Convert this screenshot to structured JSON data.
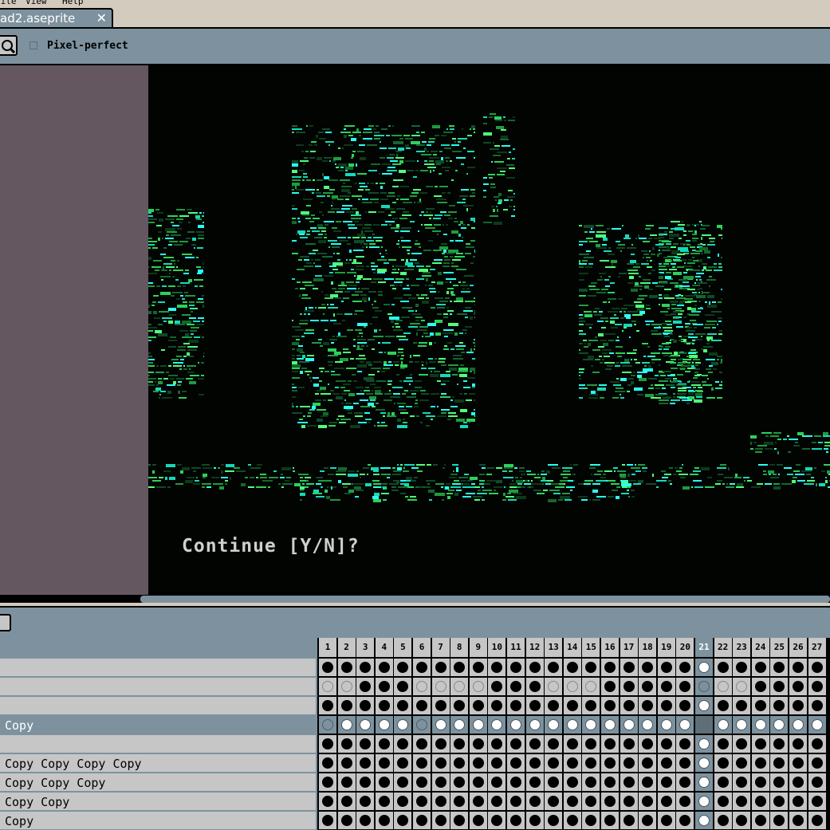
{
  "menu": {
    "items": [
      "File",
      "View",
      "Help"
    ]
  },
  "document_tab": {
    "title": "ad2.aseprite",
    "close_glyph": "✕"
  },
  "context_bar": {
    "pixel_perfect_label": "Pixel-perfect",
    "pixel_perfect_checked": false,
    "tool_icon": "zoom-icon"
  },
  "canvas": {
    "prompt_text": "Continue [Y/N]?"
  },
  "colors": {
    "panel": "#7d929e",
    "frame_bg": "#d3cbbe",
    "editor_bg": "#645760",
    "cel_bg": "#c6c6c6"
  },
  "timeline": {
    "current_frame": 21,
    "selected_layer_index": 3,
    "frames": [
      "1",
      "2",
      "3",
      "4",
      "5",
      "6",
      "7",
      "8",
      "9",
      "10",
      "11",
      "12",
      "13",
      "14",
      "15",
      "16",
      "17",
      "18",
      "19",
      "20",
      "21",
      "22",
      "23",
      "24",
      "25",
      "26",
      "27"
    ],
    "layers": [
      {
        "name": "",
        "cels": "111111111111111111111111111"
      },
      {
        "name": "",
        "cels": "001110000111000111110001111"
      },
      {
        "name": "",
        "cels": "111111111111111111111111111"
      },
      {
        "name": "Copy",
        "cels": "011110111111111111110111111"
      },
      {
        "name": "",
        "cels": "111111111111111111111111111"
      },
      {
        "name": "Copy Copy Copy Copy",
        "cels": "111111111111111111111111111"
      },
      {
        "name": "Copy Copy Copy",
        "cels": "111111111111111111111111111"
      },
      {
        "name": "Copy Copy",
        "cels": "111111111111111111111111111"
      },
      {
        "name": "Copy",
        "cels": "111111111111111111111111111"
      }
    ]
  }
}
